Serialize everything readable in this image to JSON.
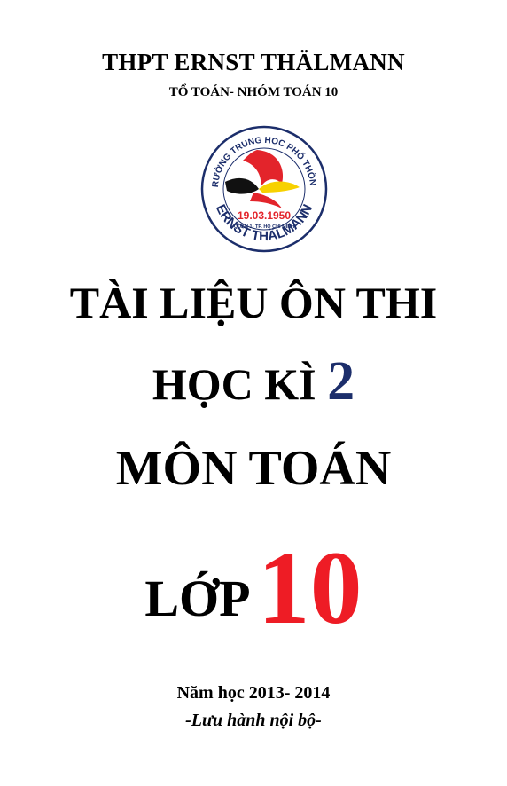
{
  "header": {
    "school": "THPT ERNST THÄLMANN",
    "department": "TỔ TOÁN- NHÓM TOÁN 10"
  },
  "logo": {
    "ring_text_top": "TRƯỜNG TRUNG HỌC PHỔ THÔNG",
    "ring_text_bottom": "ERNST THÄLMANN",
    "date": "19.03.1950",
    "address": "QUẬN 1- TP. HỒ CHÍ MINH",
    "colors": {
      "ring": "#1c2e6b",
      "red": "#e3242b",
      "yellow": "#f7d100",
      "black": "#111111"
    }
  },
  "title": {
    "line1": "TÀI LIỆU ÔN THI",
    "line2_text": "HỌC KÌ",
    "line2_number": "2",
    "line3": "MÔN TOÁN",
    "line4_text": "LỚP",
    "line4_number": "10"
  },
  "footer": {
    "year": "Năm học 2013- 2014",
    "note": "-Lưu hành nội bộ-"
  },
  "colors": {
    "number_2": "#1c2e6b",
    "number_10": "#ee1c25"
  }
}
